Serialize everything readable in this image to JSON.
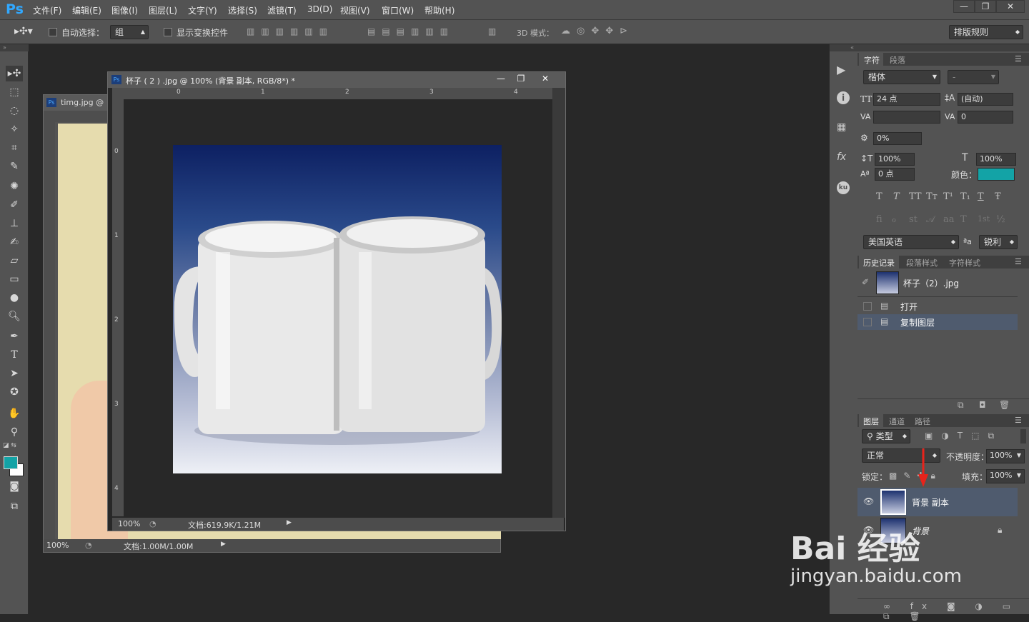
{
  "app": {
    "logo": "Ps"
  },
  "menu": [
    "文件(F)",
    "编辑(E)",
    "图像(I)",
    "图层(L)",
    "文字(Y)",
    "选择(S)",
    "滤镜(T)",
    "3D(D)",
    "视图(V)",
    "窗口(W)",
    "帮助(H)"
  ],
  "window_controls": {
    "minimize": "—",
    "restore": "❐",
    "close": "✕"
  },
  "options": {
    "auto_select_label": "自动选择：",
    "auto_select_value": "组",
    "show_transform_label": "显示变换控件",
    "mode_3d_label": "3D 模式：",
    "workspace": "排版规则"
  },
  "doc_back": {
    "title": "timg.jpg @",
    "zoom": "100%",
    "doc_info": "文档:1.00M/1.00M"
  },
  "doc_front": {
    "title": "杯子 ( 2 ) .jpg @ 100% (背景 副本, RGB/8*) *",
    "zoom": "100%",
    "doc_info": "文档:619.9K/1.21M",
    "ruler_h": [
      "0",
      "1",
      "2",
      "3",
      "4"
    ],
    "ruler_v": [
      "0",
      "1",
      "2",
      "3",
      "4"
    ]
  },
  "character_panel": {
    "tabs": [
      "字符",
      "段落"
    ],
    "font_family": "楷体",
    "font_style": "-",
    "font_size": "24 点",
    "leading": "(自动)",
    "kerning": "",
    "tracking": "0",
    "scale_pct": "0%",
    "vertical_scale": "100%",
    "horizontal_scale": "100%",
    "baseline_shift": "0 点",
    "color_label": "颜色：",
    "color_value": "#13a3a6",
    "style_buttons_1": [
      "T",
      "T",
      "TT",
      "Tт",
      "T¹",
      "T₁",
      "T",
      "Ŧ"
    ],
    "style_buttons_2": [
      "ﬁ",
      "ℴ",
      "st",
      "𝒜",
      "aa",
      "T",
      "1st",
      "½"
    ],
    "language": "美国英语",
    "aa_label": "ªa",
    "antialias": "锐利"
  },
  "history_panel": {
    "tabs": [
      "历史记录",
      "段落样式",
      "字符样式"
    ],
    "snapshot": "杯子（2）.jpg",
    "items": [
      "打开",
      "复制图层"
    ]
  },
  "layers_panel": {
    "tabs": [
      "图层",
      "通道",
      "路径"
    ],
    "filter": "类型",
    "blend_mode": "正常",
    "opacity_label": "不透明度：",
    "opacity": "100%",
    "lock_label": "锁定：",
    "fill_label": "填充：",
    "fill": "100%",
    "layers": [
      "背景 副本",
      "背景"
    ]
  },
  "panel_strip_icons": [
    "play-icon",
    "info-icon",
    "grid-icon",
    "fx-icon",
    "ku-icon"
  ],
  "watermark": {
    "brand": "Bai 经验",
    "url": "jingyan.baidu.com"
  }
}
